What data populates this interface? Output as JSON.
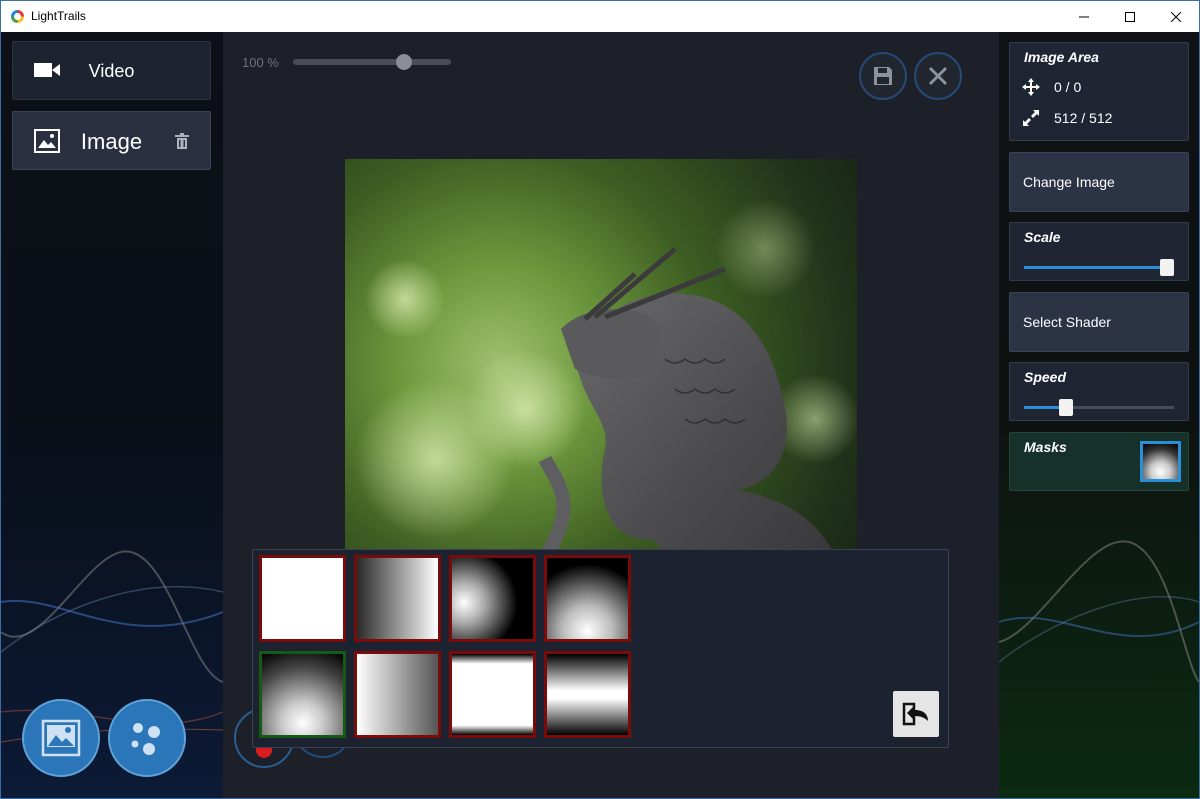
{
  "window": {
    "title": "LightTrails"
  },
  "left": {
    "video_label": "Video",
    "image_label": "Image"
  },
  "toolbar": {
    "zoom_label": "100 %",
    "zoom_level": 0.7
  },
  "masks_popup": {
    "cells": [
      {
        "kind": "solid-white",
        "selected": false
      },
      {
        "kind": "horizontal-gradient",
        "selected": false
      },
      {
        "kind": "radial-left",
        "selected": false
      },
      {
        "kind": "radial-bottom",
        "selected": false
      },
      {
        "kind": "radial-bottom-soft",
        "selected": true
      },
      {
        "kind": "horizontal-gradient-soft",
        "selected": false
      },
      {
        "kind": "vertical-band-white",
        "selected": false
      },
      {
        "kind": "horizontal-band",
        "selected": false
      }
    ]
  },
  "right": {
    "image_area": {
      "title": "Image Area",
      "position": "0 / 0",
      "size": "512 / 512"
    },
    "change_image_label": "Change Image",
    "scale": {
      "title": "Scale",
      "value": 0.95
    },
    "select_shader_label": "Select Shader",
    "speed": {
      "title": "Speed",
      "value": 0.28
    },
    "masks": {
      "title": "Masks"
    }
  },
  "colors": {
    "accent": "#2a8ed8",
    "selected_mask": "#155a15",
    "mask_border": "#7a0b0b"
  }
}
